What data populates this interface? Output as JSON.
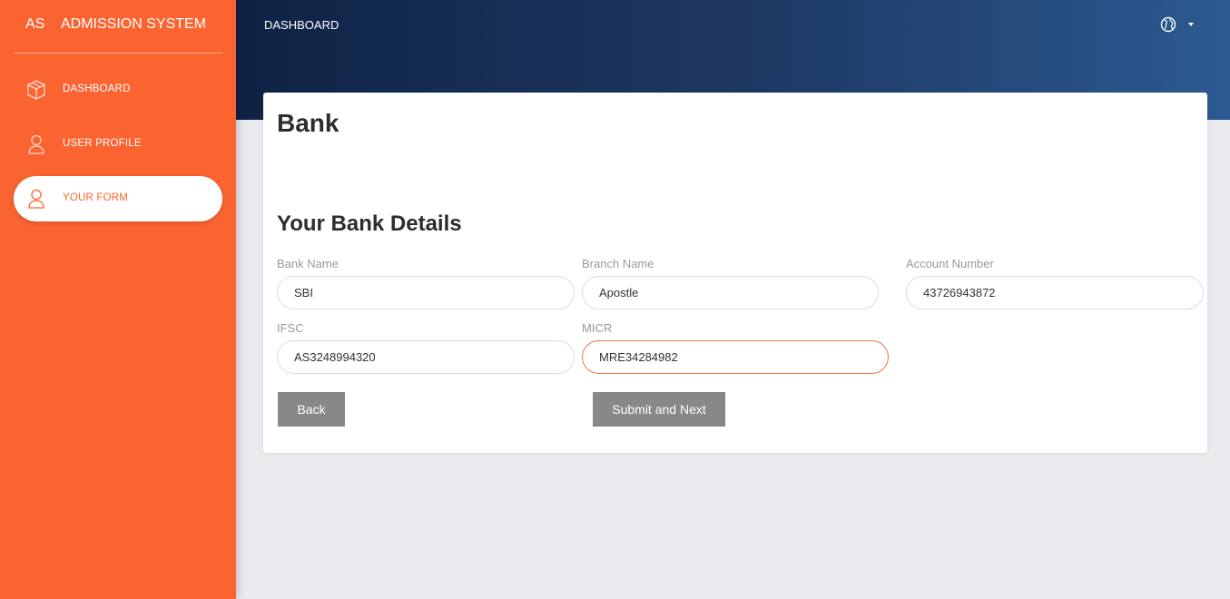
{
  "sidebar": {
    "brand_mini": "AS",
    "brand_full": "ADMISSION SYSTEM",
    "items": [
      {
        "label": "DASHBOARD",
        "icon": "box-icon"
      },
      {
        "label": "USER PROFILE",
        "icon": "user-icon"
      },
      {
        "label": "YOUR FORM",
        "icon": "user-icon",
        "active": true
      }
    ]
  },
  "header": {
    "title": "DASHBOARD",
    "language_icon": "globe-icon"
  },
  "page": {
    "title": "Bank",
    "section_title": "Your Bank Details"
  },
  "form": {
    "bank_name": {
      "label": "Bank Name",
      "value": "SBI"
    },
    "branch_name": {
      "label": "Branch Name",
      "value": "Apostle"
    },
    "account_number": {
      "label": "Account Number",
      "value": "43726943872"
    },
    "ifsc": {
      "label": "IFSC",
      "value": "AS3248994320"
    },
    "micr": {
      "label": "MICR",
      "value": "MRE34284982"
    }
  },
  "buttons": {
    "back": "Back",
    "submit": "Submit and Next"
  },
  "colors": {
    "sidebar": "#fa6431",
    "header_start": "#0f2244",
    "header_end": "#2b5a92",
    "button": "#888888",
    "focus_border": "#e9773f"
  }
}
